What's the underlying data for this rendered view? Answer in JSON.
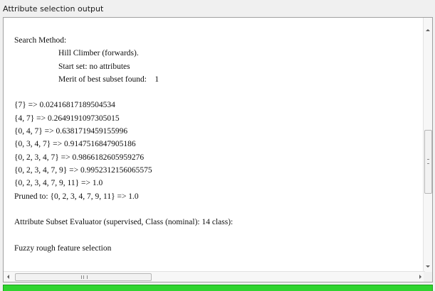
{
  "panel": {
    "title": "Attribute selection output"
  },
  "output": {
    "search_method_heading": "Search Method:",
    "method_name": "Hill Climber (forwards).",
    "start_set": "Start set: no attributes",
    "merit": "Merit of best subset found:    1",
    "subsets": [
      "{7} => 0.02416817189504534",
      "{4, 7} => 0.2649191097305015",
      "{0, 4, 7} => 0.6381719459155996",
      "{0, 3, 4, 7} => 0.9147516847905186",
      "{0, 2, 3, 4, 7} => 0.9866182605959276",
      "{0, 2, 3, 4, 7, 9} => 0.9952312156065575",
      "{0, 2, 3, 4, 7, 9, 11} => 1.0"
    ],
    "pruned": "Pruned to: {0, 2, 3, 4, 7, 9, 11} => 1.0",
    "evaluator": "Attribute Subset Evaluator (supervised, Class (nominal): 14 class):",
    "evaluator_name": "Fuzzy rough feature selection"
  },
  "status": {
    "color": "#2fd42f"
  }
}
